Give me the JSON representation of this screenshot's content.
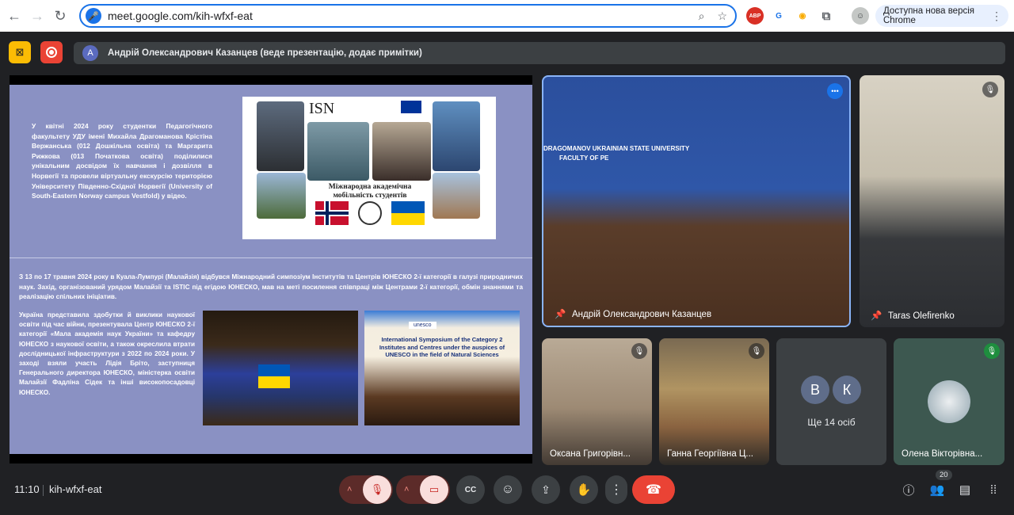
{
  "browser": {
    "url": "meet.google.com/kih-wfxf-eat",
    "update_label": "Доступна нова версія Chrome",
    "extensions": [
      "adblock-icon",
      "translate-icon",
      "extension-icon",
      "puzzle-icon",
      "profile-icon"
    ]
  },
  "meet": {
    "presenter_initial": "A",
    "presenter_banner": "Андрій Олександрович Казанцев (веде презентацію, додає примітки)"
  },
  "slide": {
    "para1": "У квітні 2024 року студентки Педагогічного факультету УДУ імені Михайла Драгоманова Крістіна Верж​анська (012 Дошкільна освіта) та Маргарита Рижкова (013 Початкова освіта) поділилися унікальним досвідом їх навчання і дозвілля в Норвегії та провели віртуальну екскурсію територією Університету Південно-Східної Норвегії (University of South-Eastern Norway campus Vestfold) у відео.",
    "collage_caption_line1": "Міжнародна академічна",
    "collage_caption_line2": "мобільність студентів",
    "para2": "З 13 по 17 травня 2024 року в Куала-Лумпурі (Малайзія) відбувся Міжнародний симпозіум Інститутів та Центрів ЮНЕСКО 2-ї категорії в галузі природничих наук. Захід, організований урядом Малайзії та ISTIC під егідою ЮНЕСКО, мав на меті посилення співпраці між Центрами 2-ї категорії, обмін знаннями та реалізацію спільних ініціатив.",
    "para3": "Україна представила здобутки й виклики наукової освіти під час війни, презентувала Центр ЮНЕСКО 2-ї категорії «Мала академія наук України» та кафедру ЮНЕСКО з наукової освіти, а також окреслила втрати дослідницької інфраструктури з 2022 по 2024 роки. У заході взяли участь Лідія Бріто, заступниця Генерального директора ЮНЕСКО, міністерка освіти Малайзії Фадліна Сідек та інші високопосадовці ЮНЕСКО.",
    "photo2_sign": "International Symposium of the Category 2 Institutes and Centres under the auspices of UNESCO in the field of Natural Sciences",
    "photo2_logo": "unesco",
    "room_banner": "DRAGOMANOV UKRAINIAN STATE UNIVERSITY",
    "room_banner2": "FACULTY OF PE"
  },
  "participants": {
    "main": "Андрій Олександрович Казанцев",
    "right": "Taras Olefirenko",
    "p1": "Оксана Григорівн...",
    "p2": "Ганна Георгіївна Ц...",
    "group_initial1": "В",
    "group_initial2": "К",
    "group_label": "Ще 14 осіб",
    "p4": "Олена Вікторівна..."
  },
  "footer": {
    "time": "11:10",
    "meeting_code": "kih-wfxf-eat",
    "people_count": "20"
  },
  "colors": {
    "meet_bg": "#202124",
    "end_call": "#ea4335",
    "muted_btn": "#f9dedc",
    "active_outline": "#8ab4f8"
  }
}
